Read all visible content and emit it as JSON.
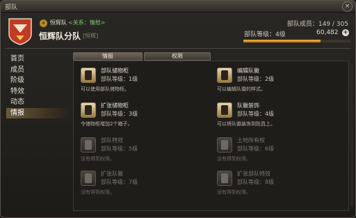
{
  "window": {
    "title": "部队",
    "close_label": "×"
  },
  "company": {
    "level_badge": "4",
    "short_name": "恒辉队",
    "relation": "<关系：情愁>",
    "name": "恒辉队分队",
    "tag": "[恒辉]",
    "members_text": "部队成员：149 / 305",
    "rank_text": "部队等级：4级",
    "points": "60,482",
    "progress": 0.72,
    "colors": {
      "accent": "#f4a020",
      "relation": "#7fc86a"
    }
  },
  "nav": {
    "items": [
      {
        "label": "首页",
        "active": false
      },
      {
        "label": "成员",
        "active": false
      },
      {
        "label": "阶级",
        "active": false
      },
      {
        "label": "特效",
        "active": false
      },
      {
        "label": "动态",
        "active": false
      },
      {
        "label": "情报",
        "active": true
      }
    ]
  },
  "tabs": [
    {
      "label": "情报",
      "active": true
    },
    {
      "label": "权限",
      "active": false
    }
  ],
  "actions": [
    {
      "icon": "chest-icon",
      "name": "部队储物柜",
      "level": "部队等级：1级",
      "desc": "可以使用部队储物柜。",
      "locked": false
    },
    {
      "icon": "crest-edit-icon",
      "name": "编辑队徽",
      "level": "部队等级：2级",
      "desc": "可以编辑队徽的样式。",
      "locked": false
    },
    {
      "icon": "chest-expand-icon",
      "name": "扩张储物柜",
      "level": "部队等级：3级",
      "desc": "令储物柜增加2个箱子。",
      "locked": false
    },
    {
      "icon": "armor-icon",
      "name": "队徽装饰",
      "level": "部队等级：4级",
      "desc": "可以将队徽装饰到防具上。",
      "locked": false
    },
    {
      "icon": "star-icon",
      "name": "部队特效",
      "level": "部队等级：5级",
      "desc": "没有得到权限。",
      "locked": true
    },
    {
      "icon": "house-icon",
      "name": "土地所有权",
      "level": "部队等级：6级",
      "desc": "没有得到权限。",
      "locked": true
    },
    {
      "icon": "crest-expand-icon",
      "name": "扩张队徽",
      "level": "部队等级：7级",
      "desc": "没有得到权限。",
      "locked": true
    },
    {
      "icon": "star-expand-icon",
      "name": "扩张部队特效",
      "level": "部队等级：8级",
      "desc": "没有得到权限。",
      "locked": true
    }
  ]
}
